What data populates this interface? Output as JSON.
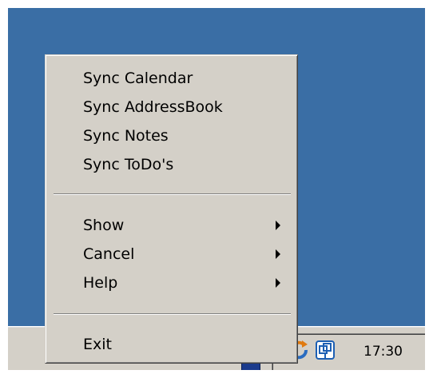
{
  "menu": {
    "sync_items": [
      {
        "label": "Sync Calendar"
      },
      {
        "label": "Sync AddressBook"
      },
      {
        "label": "Sync Notes"
      },
      {
        "label": "Sync ToDo's"
      }
    ],
    "submenu_items": [
      {
        "label": "Show"
      },
      {
        "label": "Cancel"
      },
      {
        "label": "Help"
      }
    ],
    "exit_label": "Exit"
  },
  "tray": {
    "clock": "17:30",
    "icons": [
      "sync-icon",
      "network-icon",
      "app-icon"
    ]
  },
  "colors": {
    "desktop": "#3a6ea5",
    "menu_face": "#d4d0c8"
  }
}
